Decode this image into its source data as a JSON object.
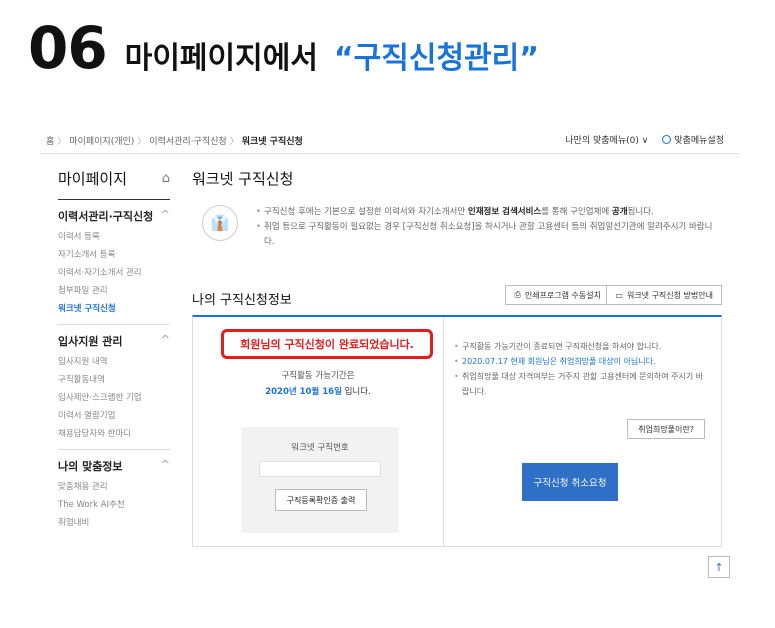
{
  "headline": {
    "step": "06",
    "text": "마이페이지에서",
    "quote": "“구직신청관리”"
  },
  "topbar": {
    "breadcrumb": [
      "홈",
      "마이페이지(개인)",
      "이력서관리·구직신청",
      "워크넷 구직신청"
    ],
    "custom_menu": "나만의 맞춤메뉴(0) ∨",
    "custom_setting": "맞춤메뉴설정"
  },
  "sidebar": {
    "title": "마이페이지",
    "groups": [
      {
        "label": "이력서관리·구직신청",
        "items": [
          "이력서 등록",
          "자기소개서 등록",
          "이력서·자기소개서 관리",
          "첨부파일 관리",
          "워크넷 구직신청"
        ]
      },
      {
        "label": "입사지원 관리",
        "items": [
          "입사지원 내역",
          "구직활동내역",
          "입사제안·스크랩한 기업",
          "이력서 열람기업",
          "채용담당자와 한마디"
        ]
      },
      {
        "label": "나의 맞춤정보",
        "items": [
          "맞춤채용 관리",
          "The Work AI추천",
          "취업내비"
        ]
      }
    ]
  },
  "main": {
    "title": "워크넷 구직신청",
    "notes": [
      {
        "pre": "구직신청 후에는 기본으로 설정한 이력서와 자기소개서만 ",
        "bold": "인재정보 검색서비스",
        "mid": "를 통해 구인업체에 ",
        "bold2": "공개",
        "post": "됩니다."
      },
      {
        "pre": "취업 등으로 구직활동이 필요없는 경우 [구직신청 취소요청]을 하시거나 관할 고용센터 등의 취업알선기관에 알려주시기 바랍니다."
      }
    ],
    "sub_title": "나의 구직신청정보",
    "print_button": "인쇄프로그램 수동설치",
    "guide_button": "워크넷 구직신청 방법안내"
  },
  "panel": {
    "complete_msg": "회원님의 구직신청이 완료되었습니다.",
    "period_label": "구직활동 가능기간은",
    "period_date": "2020년 10월 16일",
    "period_suffix": " 입니다.",
    "number_label": "워크넷 구직번호",
    "number_value": "",
    "cert_button": "구직등록확인증 출력",
    "right_notes": [
      {
        "text": "구직활동 가능기간이 종료되면 구직재신청을 하셔야 합니다.",
        "blue": false
      },
      {
        "text": "2020.07.17 현재 회원님은 취업희망풀 대상이 아닙니다.",
        "blue": true
      },
      {
        "text": "취업희망풀 대상 자격여부는 거주지 관할 고용센터에 문의하여 주시기 바랍니다.",
        "blue": false
      }
    ],
    "what_button": "취업희망풀이란?",
    "cancel_button": "구직신청 취소요청"
  },
  "icons": {
    "home": "home-icon",
    "shirt": "shirt-icon",
    "globe": "globe-icon",
    "scroll_top": "arrow-up-icon"
  },
  "colors": {
    "accent": "#1a73d9",
    "highlight": "#e01e1e",
    "cancel_button": "#2f6fc6"
  }
}
